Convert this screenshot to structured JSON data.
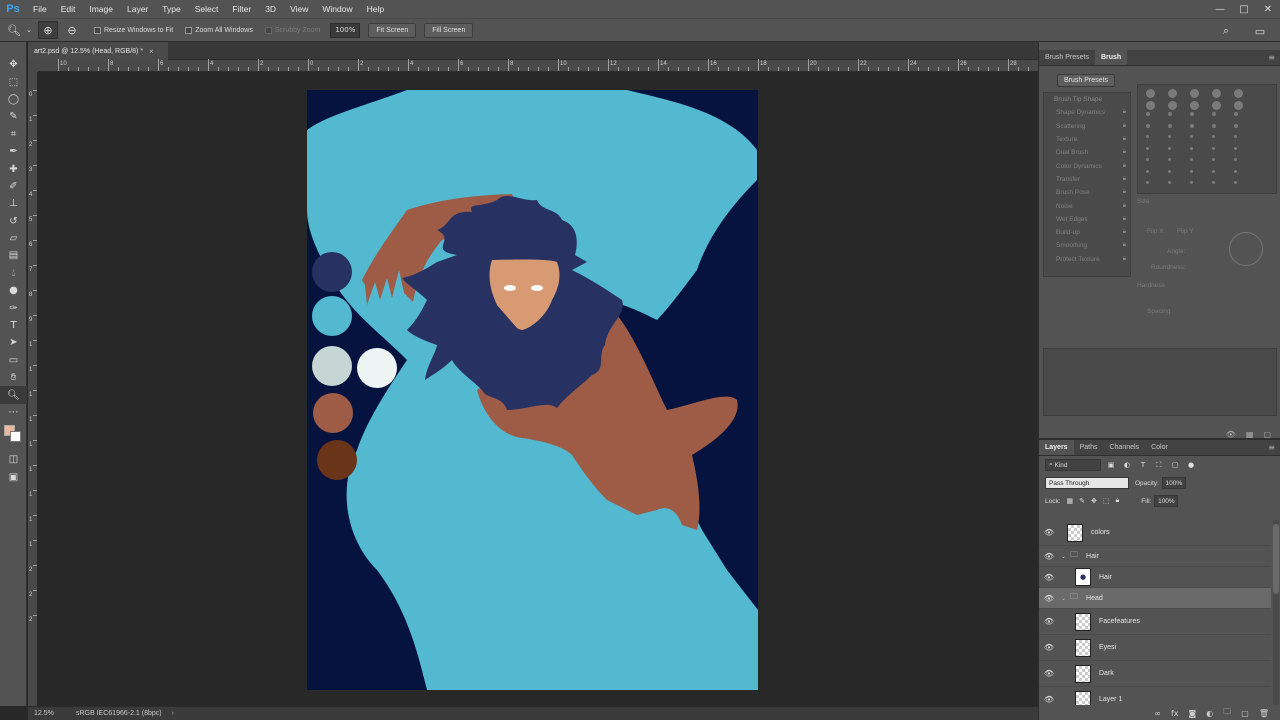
{
  "app": {
    "logo": "Ps",
    "menus": [
      "File",
      "Edit",
      "Image",
      "Layer",
      "Type",
      "Select",
      "Filter",
      "3D",
      "View",
      "Window",
      "Help"
    ],
    "window_controls": [
      "—",
      "□",
      "✕"
    ]
  },
  "options_bar": {
    "resize_windows_label": "Resize Windows to Fit",
    "zoom_all_label": "Zoom All Windows",
    "scrubby_zoom_label": "Scrubby Zoom",
    "zoom_value": "100%",
    "fit_screen_label": "Fit Screen",
    "fill_screen_label": "Fill Screen"
  },
  "document": {
    "tab_title": "art2.psd @ 12.5% (Head, RGB/8) *",
    "close_glyph": "×"
  },
  "rulers": {
    "top_labels": [
      "10",
      "8",
      "6",
      "4",
      "2",
      "0",
      "2",
      "4",
      "6",
      "8",
      "10",
      "12",
      "14",
      "16",
      "18",
      "20",
      "22",
      "24",
      "26",
      "28"
    ],
    "left_labels": [
      "0",
      "1",
      "2",
      "3",
      "4",
      "5",
      "6",
      "7",
      "8",
      "9",
      "1",
      "1",
      "1",
      "1",
      "1",
      "1",
      "1",
      "1",
      "1",
      "2",
      "2",
      "2"
    ]
  },
  "status_bar": {
    "zoom": "12.5%",
    "profile": "sRGB IEC61966-2.1 (8bpc)",
    "arrow": "›"
  },
  "colors": {
    "canvas_bg": "#06133e",
    "shirt": "#52b9d0",
    "skin": "#9e5c47",
    "hair": "#283262",
    "face": "#d89a72",
    "fg_swatch": "#e8b8a0",
    "bg_swatch": "#ffffff",
    "palette": [
      "#283262",
      "#52b9d0",
      "#c6d6d4",
      "#eef3f3",
      "#9e5c47",
      "#6a3419"
    ]
  },
  "brush_panel": {
    "tabs": [
      "Brush Presets",
      "Brush"
    ],
    "active_tab": "Brush",
    "presets_button": "Brush Presets",
    "options": [
      "Brush Tip Shape",
      "Shape Dynamics",
      "Scattering",
      "Texture",
      "Dual Brush",
      "Color Dynamics",
      "Transfer",
      "Brush Pose",
      "Noise",
      "Wet Edges",
      "Build-up",
      "Smoothing",
      "Protect Texture"
    ],
    "size_label": "Size",
    "flip_x": "Flip X",
    "flip_y": "Flip Y",
    "angle_label": "Angle:",
    "roundness_label": "Roundness:",
    "hardness_label": "Hardness",
    "spacing_label": "Spacing"
  },
  "layers_panel": {
    "tabs": [
      "Layers",
      "Paths",
      "Channels",
      "Color"
    ],
    "active_tab": "Layers",
    "kind_label": "Kind",
    "blend_mode": "Pass Through",
    "opacity_label": "Opacity:",
    "opacity_value": "100%",
    "lock_label": "Lock:",
    "fill_label": "Fill:",
    "fill_value": "100%",
    "layers": [
      {
        "name": "colors",
        "type": "layer",
        "selected": false
      },
      {
        "name": "Hair",
        "type": "group",
        "selected": false
      },
      {
        "name": "Hair",
        "type": "layer",
        "selected": false
      },
      {
        "name": "Head",
        "type": "group",
        "selected": true
      },
      {
        "name": "Facefeatures",
        "type": "layer",
        "selected": false
      },
      {
        "name": "Eyesi",
        "type": "layer",
        "selected": false
      },
      {
        "name": "Dark",
        "type": "layer",
        "selected": false
      },
      {
        "name": "Layer 1",
        "type": "layer",
        "selected": false
      }
    ]
  }
}
